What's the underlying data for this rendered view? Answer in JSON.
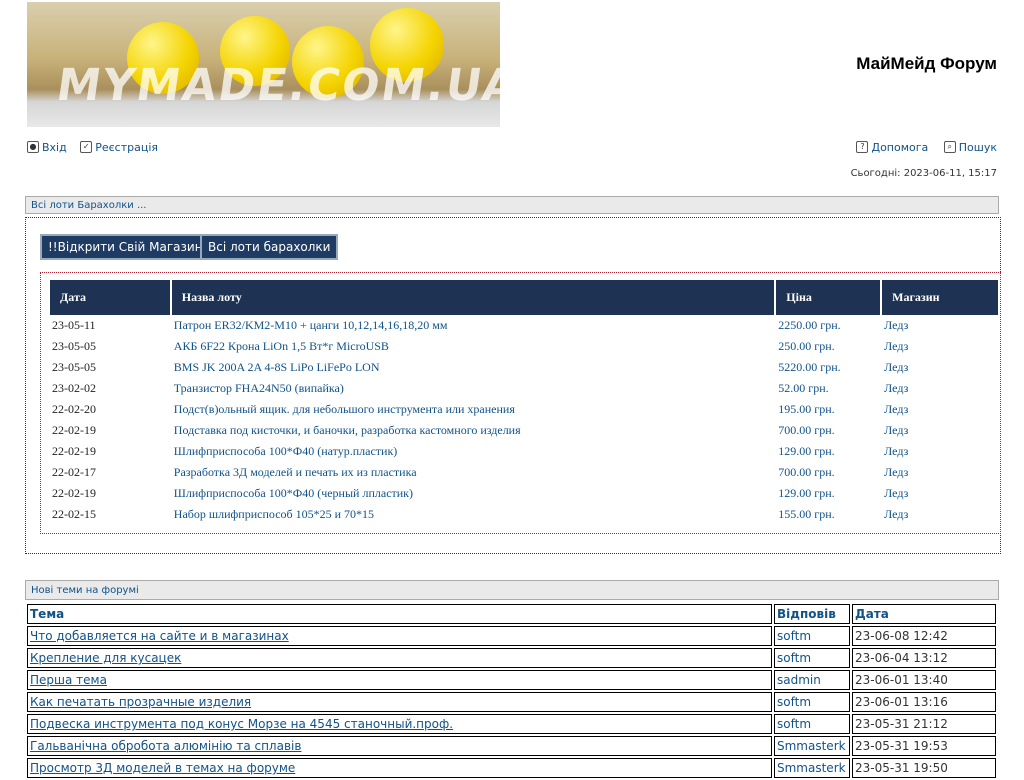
{
  "header": {
    "banner_watermark": "MYMADE.COM.UA",
    "site_title": "МайМейд Форум"
  },
  "nav": {
    "login": "Вхід",
    "register": "Реєстрація",
    "help": "Допомога",
    "search": "Пошук"
  },
  "today": "Сьогодні: 2023-06-11, 15:17",
  "market": {
    "heading": "Всі лоти Барахолки ...",
    "open_shop_button": "!!Відкрити Свій Магазин",
    "all_lots_button": "Всі лоти барахолки",
    "columns": [
      "Дата",
      "Назва лоту",
      "Ціна",
      "Магазин"
    ],
    "rows": [
      {
        "date": "23-05-11",
        "name": "Патрон ER32/KM2-M10 + цанги 10,12,14,16,18,20 мм",
        "price": "2250.00 грн.",
        "shop": "Ледз"
      },
      {
        "date": "23-05-05",
        "name": "АКБ 6F22 Крона LiOn 1,5 Вт*г MicroUSB",
        "price": "250.00 грн.",
        "shop": "Ледз"
      },
      {
        "date": "23-05-05",
        "name": "BMS JK 200A 2A 4-8S LiPo LiFePo LON",
        "price": "5220.00 грн.",
        "shop": "Ледз"
      },
      {
        "date": "23-02-02",
        "name": "Транзистор FHA24N50 (випайка)",
        "price": "52.00 грн.",
        "shop": "Ледз"
      },
      {
        "date": "22-02-20",
        "name": "Подст(в)ольный ящик. для небольшого инструмента или хранения",
        "price": "195.00 грн.",
        "shop": "Ледз"
      },
      {
        "date": "22-02-19",
        "name": "Подставка под кисточки, и баночки, разработка кастомного изделия",
        "price": "700.00 грн.",
        "shop": "Ледз"
      },
      {
        "date": "22-02-19",
        "name": "Шлифприспособа 100*Ф40 (натур.пластик)",
        "price": "129.00 грн.",
        "shop": "Ледз"
      },
      {
        "date": "22-02-17",
        "name": "Разработка 3Д моделей и печать их из пластика",
        "price": "700.00 грн.",
        "shop": "Ледз"
      },
      {
        "date": "22-02-19",
        "name": "Шлифприспособа 100*Ф40 (черный лпластик)",
        "price": "129.00 грн.",
        "shop": "Ледз"
      },
      {
        "date": "22-02-15",
        "name": "Набор шлифприспособ 105*25 и 70*15",
        "price": "155.00 грн.",
        "shop": "Ледз"
      }
    ]
  },
  "forum": {
    "heading": "Нові теми на форумі",
    "columns": [
      "Тема",
      "Відповів",
      "Дата"
    ],
    "rows": [
      {
        "topic": "Что добавляется на сайте и в магазинах",
        "author": "softm",
        "date": "23-06-08 12:42"
      },
      {
        "topic": "Крепление для кусацек",
        "author": "softm",
        "date": "23-06-04 13:12"
      },
      {
        "topic": "Перша тема",
        "author": "sadmin",
        "date": "23-06-01 13:40"
      },
      {
        "topic": "Как печатать прозрачные изделия",
        "author": "softm",
        "date": "23-06-01 13:16"
      },
      {
        "topic": "Подвеска инструмента под конус Морзе на 4545 станочный.проф.",
        "author": "softm",
        "date": "23-05-31 21:12"
      },
      {
        "topic": "Гальванічна обробота алюмінію та сплавів",
        "author": "Smmasterk",
        "date": "23-05-31 19:53"
      },
      {
        "topic": "Просмотр 3Д моделей в темах на форуме",
        "author": "Smmasterk",
        "date": "23-05-31 19:50"
      }
    ]
  }
}
